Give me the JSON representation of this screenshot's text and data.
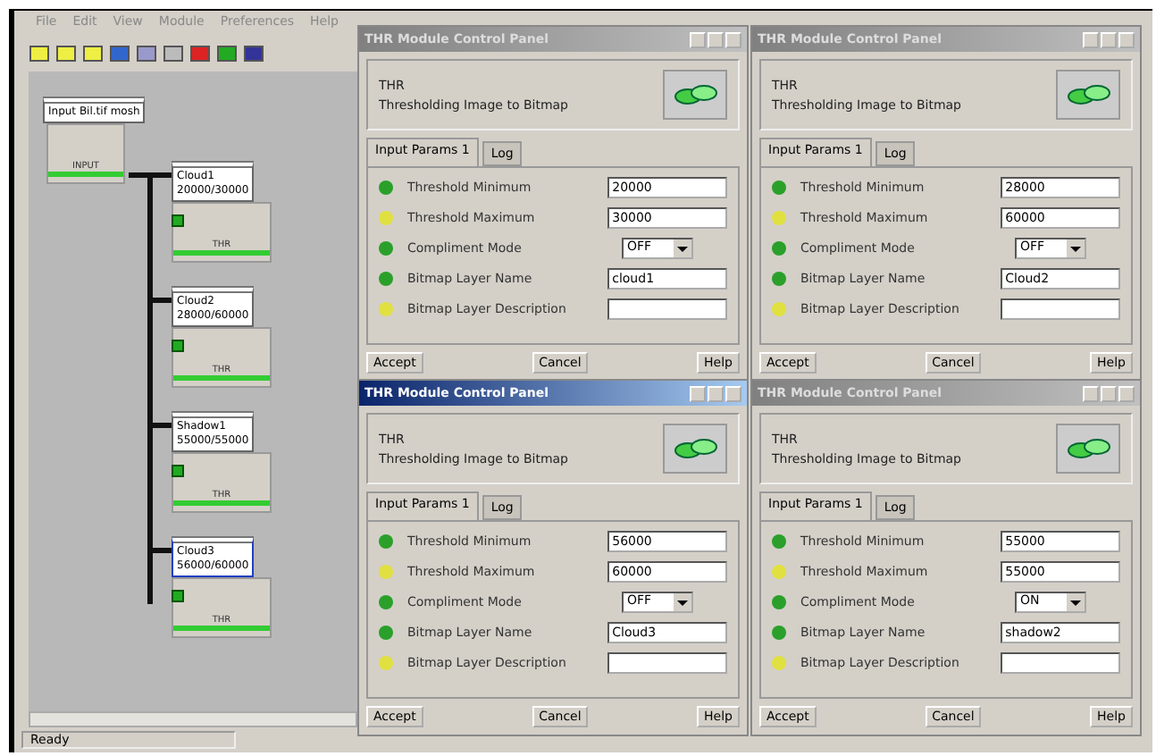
{
  "menu": [
    "File",
    "Edit",
    "View",
    "Module",
    "Preferences",
    "Help"
  ],
  "canvas": {
    "nodes": [
      {
        "kind": "input",
        "label": "Input Bil.tif mosh",
        "caption": "INPUT",
        "selected": false
      },
      {
        "kind": "module",
        "title": "Cloud1",
        "value": "20000/30000",
        "caption": "THR",
        "selected": false
      },
      {
        "kind": "module",
        "title": "Cloud2",
        "value": "28000/60000",
        "caption": "THR",
        "selected": false
      },
      {
        "kind": "module",
        "title": "Shadow1",
        "value": "55000/55000",
        "caption": "THR",
        "selected": false
      },
      {
        "kind": "module",
        "title": "Cloud3",
        "value": "56000/60000",
        "caption": "THR",
        "selected": true
      }
    ]
  },
  "status_bar": "Ready",
  "panels": [
    {
      "title": "THR Module Control Panel",
      "active": false,
      "code": "THR",
      "description": "Thresholding Image to Bitmap",
      "tabs": [
        {
          "label": "Input Params 1",
          "selected": true
        },
        {
          "label": "Log",
          "selected": false
        }
      ],
      "params": [
        {
          "label": "Threshold Minimum",
          "color": "#2aa02a",
          "kind": "text",
          "value": "20000"
        },
        {
          "label": "Threshold Maximum",
          "color": "#e0e040",
          "kind": "text",
          "value": "30000"
        },
        {
          "label": "Compliment Mode",
          "color": "#2aa02a",
          "kind": "dropdown",
          "value": "OFF"
        },
        {
          "label": "Bitmap Layer Name",
          "color": "#2aa02a",
          "kind": "text",
          "value": "cloud1"
        },
        {
          "label": "Bitmap Layer Description",
          "color": "#e0e040",
          "kind": "text"
        }
      ],
      "buttons": [
        "Accept",
        "Cancel",
        "Help"
      ]
    },
    {
      "title": "THR Module Control Panel",
      "active": false,
      "code": "THR",
      "description": "Thresholding Image to Bitmap",
      "tabs": [
        {
          "label": "Input Params 1",
          "selected": true
        },
        {
          "label": "Log",
          "selected": false
        }
      ],
      "params": [
        {
          "label": "Threshold Minimum",
          "color": "#2aa02a",
          "kind": "text",
          "value": "28000"
        },
        {
          "label": "Threshold Maximum",
          "color": "#e0e040",
          "kind": "text",
          "value": "60000"
        },
        {
          "label": "Compliment Mode",
          "color": "#2aa02a",
          "kind": "dropdown",
          "value": "OFF"
        },
        {
          "label": "Bitmap Layer Name",
          "color": "#2aa02a",
          "kind": "text",
          "value": "Cloud2"
        },
        {
          "label": "Bitmap Layer Description",
          "color": "#e0e040",
          "kind": "text"
        }
      ],
      "buttons": [
        "Accept",
        "Cancel",
        "Help"
      ]
    },
    {
      "title": "THR Module Control Panel",
      "active": true,
      "code": "THR",
      "description": "Thresholding Image to Bitmap",
      "tabs": [
        {
          "label": "Input Params 1",
          "selected": true
        },
        {
          "label": "Log",
          "selected": false
        }
      ],
      "params": [
        {
          "label": "Threshold Minimum",
          "color": "#2aa02a",
          "kind": "text",
          "value": "56000"
        },
        {
          "label": "Threshold Maximum",
          "color": "#e0e040",
          "kind": "text",
          "value": "60000"
        },
        {
          "label": "Compliment Mode",
          "color": "#2aa02a",
          "kind": "dropdown",
          "value": "OFF"
        },
        {
          "label": "Bitmap Layer Name",
          "color": "#2aa02a",
          "kind": "text",
          "value": "Cloud3"
        },
        {
          "label": "Bitmap Layer Description",
          "color": "#e0e040",
          "kind": "text"
        }
      ],
      "buttons": [
        "Accept",
        "Cancel",
        "Help"
      ]
    },
    {
      "title": "THR Module Control Panel",
      "active": false,
      "code": "THR",
      "description": "Thresholding Image to Bitmap",
      "tabs": [
        {
          "label": "Input Params 1",
          "selected": true
        },
        {
          "label": "Log",
          "selected": false
        }
      ],
      "params": [
        {
          "label": "Threshold Minimum",
          "color": "#2aa02a",
          "kind": "text",
          "value": "55000"
        },
        {
          "label": "Threshold Maximum",
          "color": "#e0e040",
          "kind": "text",
          "value": "55000"
        },
        {
          "label": "Compliment Mode",
          "color": "#2aa02a",
          "kind": "dropdown",
          "value": "ON"
        },
        {
          "label": "Bitmap Layer Name",
          "color": "#2aa02a",
          "kind": "text",
          "value": "shadow2"
        },
        {
          "label": "Bitmap Layer Description",
          "color": "#e0e040",
          "kind": "text"
        }
      ],
      "buttons": [
        "Accept",
        "Cancel",
        "Help"
      ]
    }
  ]
}
